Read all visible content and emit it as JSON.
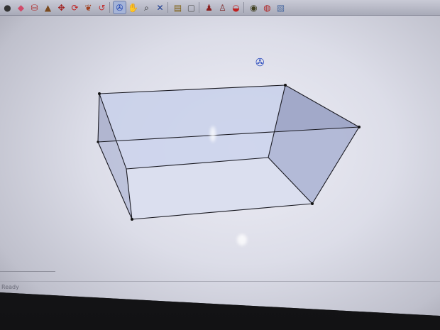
{
  "toolbar": {
    "tools": [
      {
        "name": "circle-tool-icon",
        "glyph": "●",
        "color": "#333",
        "active": false
      },
      {
        "name": "eraser-icon",
        "glyph": "◆",
        "color": "#d04a6a",
        "active": false
      },
      {
        "name": "paint-bucket-icon",
        "glyph": "⛁",
        "color": "#b03030",
        "active": false
      },
      {
        "name": "push-pull-icon",
        "glyph": "▲",
        "color": "#7a4a20",
        "active": false
      },
      {
        "name": "move-icon",
        "glyph": "✥",
        "color": "#a02020",
        "active": false
      },
      {
        "name": "rotate-icon",
        "glyph": "⟳",
        "color": "#c02020",
        "active": false
      },
      {
        "name": "follow-me-icon",
        "glyph": "❦",
        "color": "#a04020",
        "active": false
      },
      {
        "name": "offset-icon",
        "glyph": "↺",
        "color": "#c03030",
        "active": false
      },
      {
        "name": "sep"
      },
      {
        "name": "orbit-icon",
        "glyph": "✇",
        "color": "#1a3fb0",
        "active": true
      },
      {
        "name": "pan-icon",
        "glyph": "✋",
        "color": "#444",
        "active": false
      },
      {
        "name": "zoom-icon",
        "glyph": "⌕",
        "color": "#222",
        "active": false
      },
      {
        "name": "zoom-extents-icon",
        "glyph": "✕",
        "color": "#1a3a90",
        "active": false
      },
      {
        "name": "sep"
      },
      {
        "name": "get-models-icon",
        "glyph": "▤",
        "color": "#806010",
        "active": false
      },
      {
        "name": "share-model-icon",
        "glyph": "▢",
        "color": "#555",
        "active": false
      },
      {
        "name": "sep"
      },
      {
        "name": "walk-icon",
        "glyph": "♟",
        "color": "#8a2020",
        "active": false
      },
      {
        "name": "position-camera-icon",
        "glyph": "♙",
        "color": "#7a2020",
        "active": false
      },
      {
        "name": "look-around-icon",
        "glyph": "◒",
        "color": "#c02020",
        "active": false
      },
      {
        "name": "sep"
      },
      {
        "name": "components-icon",
        "glyph": "◉",
        "color": "#404020",
        "active": false
      },
      {
        "name": "materials-icon",
        "glyph": "◍",
        "color": "#b02020",
        "active": false
      },
      {
        "name": "styles-icon",
        "glyph": "▧",
        "color": "#4a6aa0",
        "active": false
      }
    ]
  },
  "status": {
    "text": "Ready"
  },
  "colors": {
    "edge": "#1a1a22",
    "face_light": "#c8d0ea",
    "face_dark": "#9aa2c4",
    "face_bottom": "#dfe2ee",
    "accent": "#2244bb"
  },
  "cursor_icon": "orbit-cursor-icon"
}
